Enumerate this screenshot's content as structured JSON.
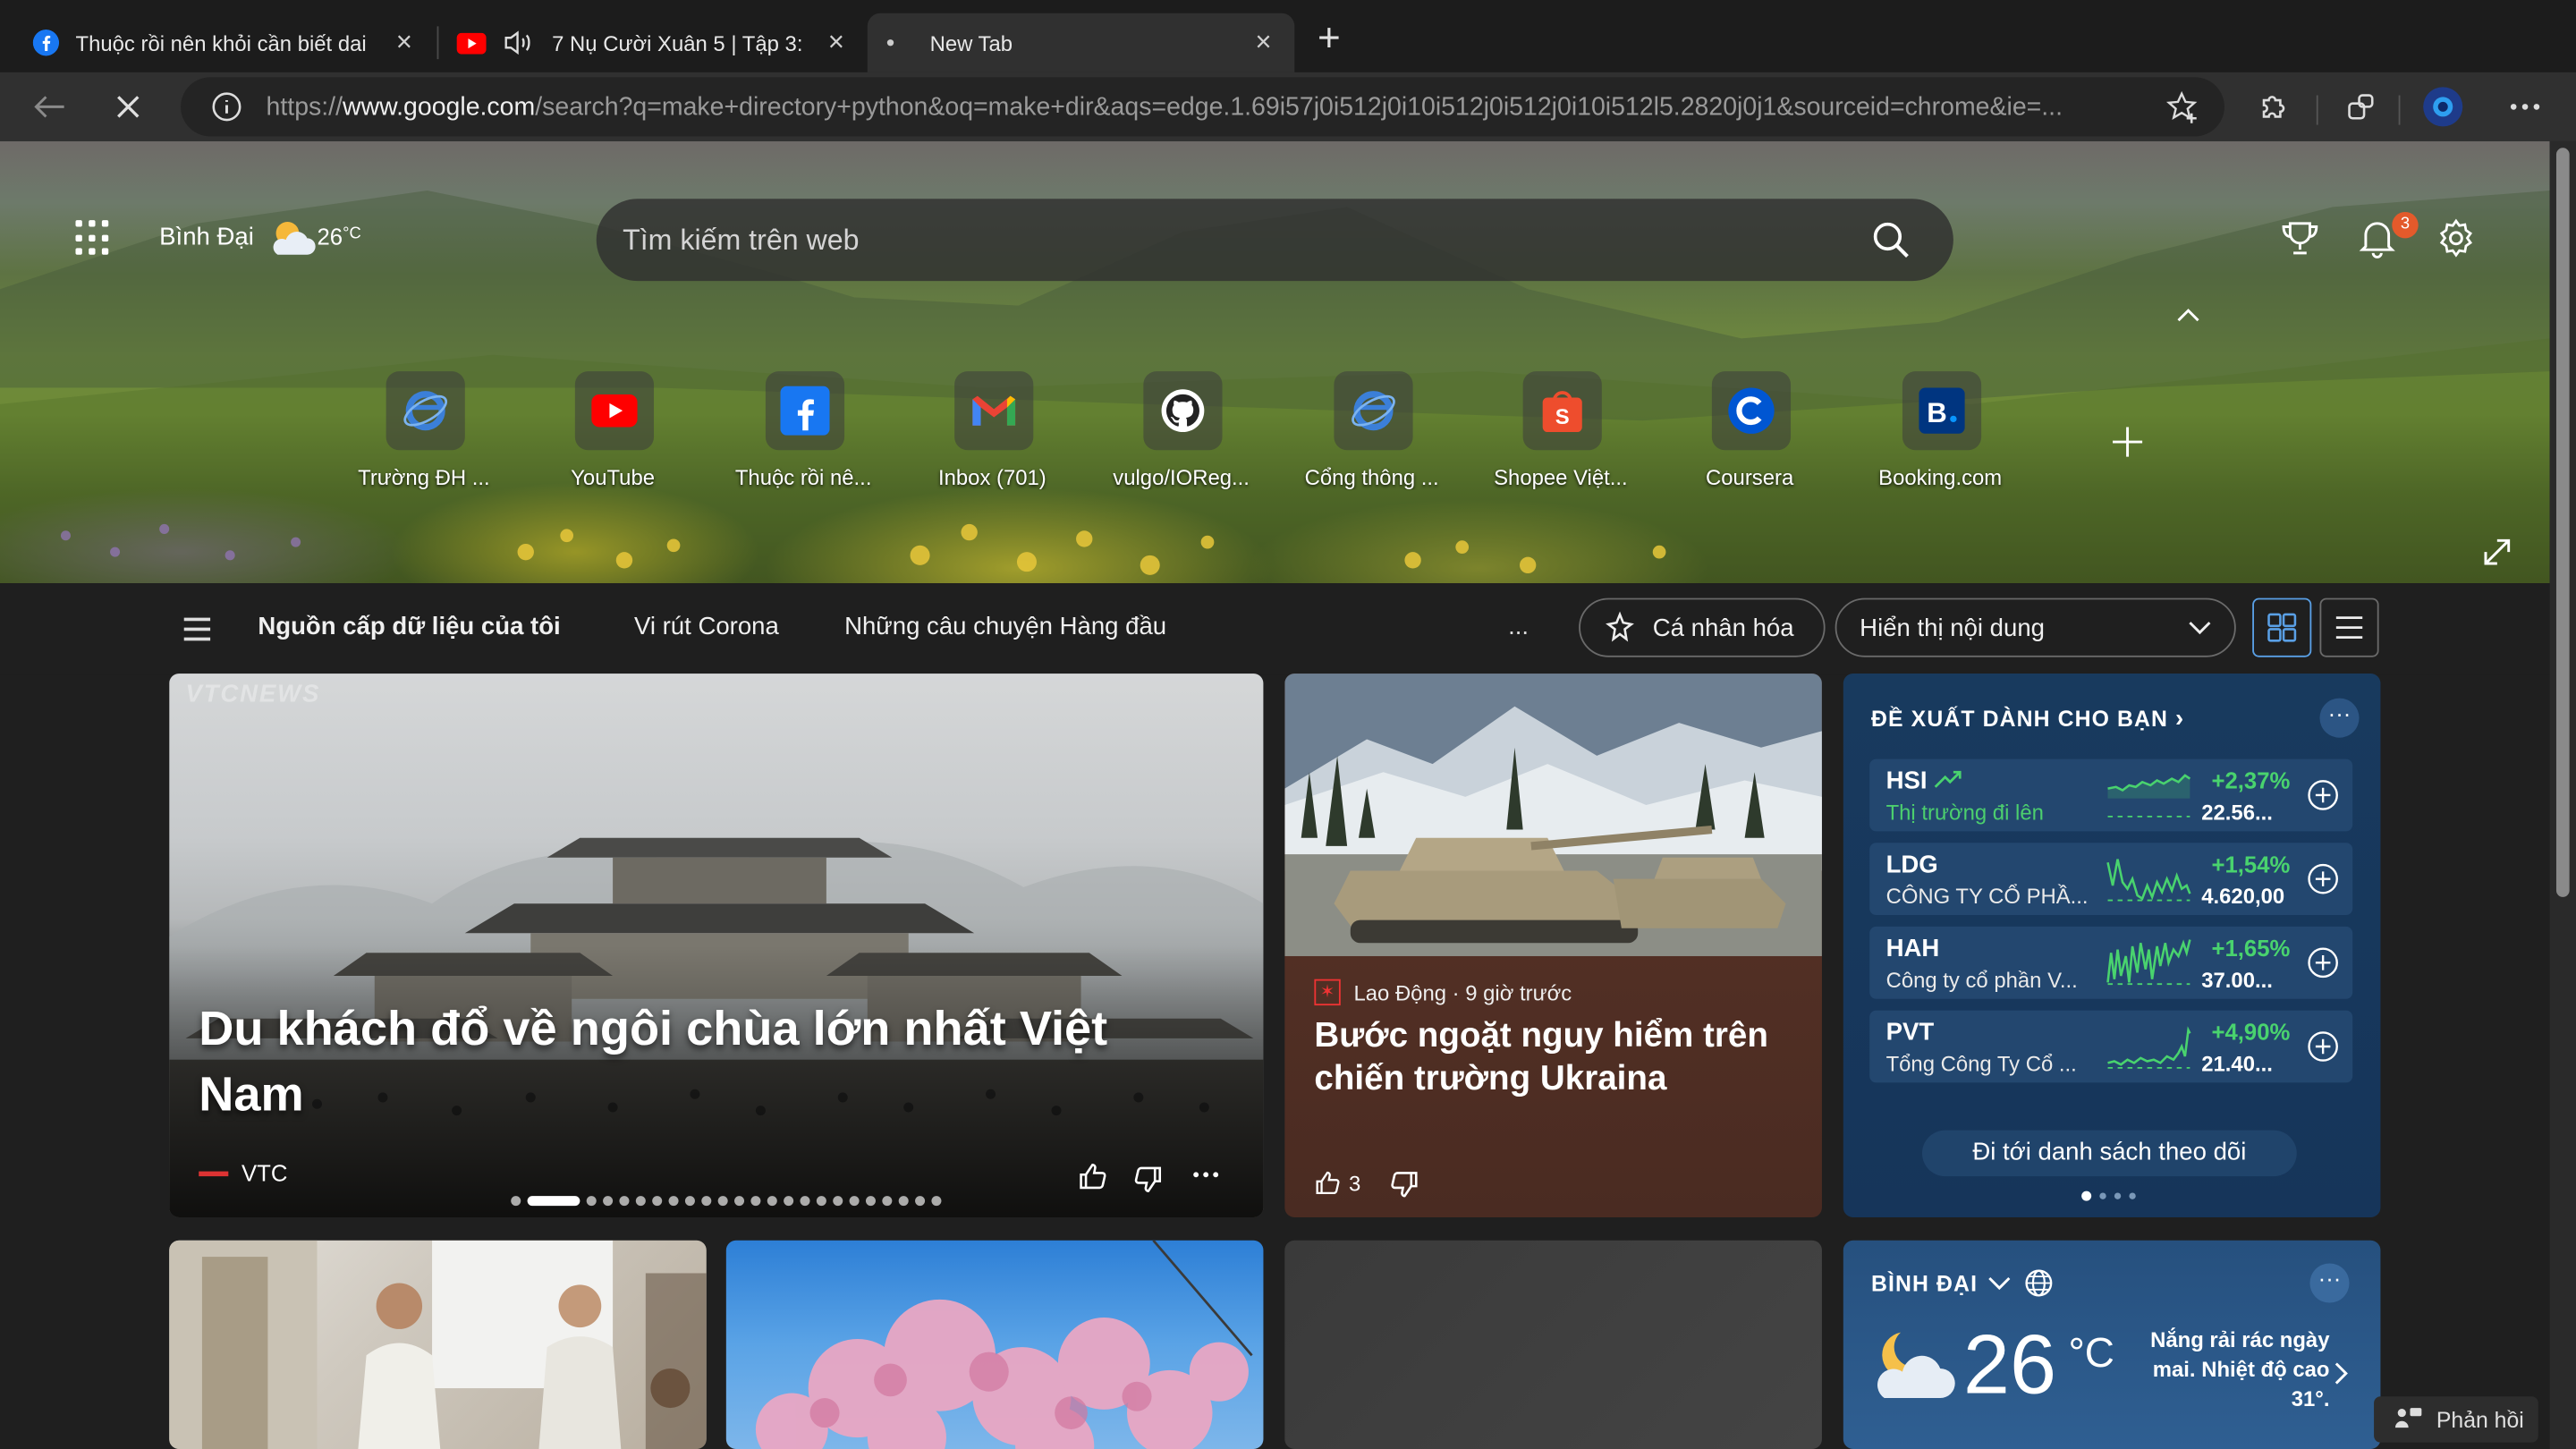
{
  "tabs": [
    {
      "title": "Thuộc rồi nên khỏi cần biết dai",
      "favicon": "facebook-icon",
      "active": false
    },
    {
      "title": "7 Nụ Cười Xuân 5 | Tập 3:",
      "favicon": "youtube-icon",
      "active": false,
      "audio": true
    },
    {
      "title": "New Tab",
      "favicon": "loading-dot",
      "active": true
    }
  ],
  "address_bar": {
    "scheme": "https://",
    "host": "www.google.com",
    "path": "/search?q=make+directory+python&oq=make+dir&aqs=edge.1.69i57j0i512j0i10i512j0i512j0i10i512l5.2820j0j1&sourceid=chrome&ie=..."
  },
  "header": {
    "location": "Bình Đại",
    "temperature": "26",
    "temp_unit": "°C",
    "search_placeholder": "Tìm kiếm trên web",
    "notification_count": "3"
  },
  "quick_links": [
    {
      "label": "Trường ĐH ...",
      "icon": "ie-globe-icon"
    },
    {
      "label": "YouTube",
      "icon": "youtube-icon"
    },
    {
      "label": "Thuộc rồi nê...",
      "icon": "facebook-icon"
    },
    {
      "label": "Inbox (701)",
      "icon": "gmail-icon"
    },
    {
      "label": "vulgo/IOReg...",
      "icon": "github-icon"
    },
    {
      "label": "Cổng thông ...",
      "icon": "ie-globe-icon"
    },
    {
      "label": "Shopee Việt...",
      "icon": "shopee-icon"
    },
    {
      "label": "Coursera",
      "icon": "coursera-icon"
    },
    {
      "label": "Booking.com",
      "icon": "booking-icon"
    }
  ],
  "feed_nav": {
    "items": [
      "Nguồn cấp dữ liệu của tôi",
      "Vi rút Corona",
      "Những câu chuyện Hàng đầu"
    ],
    "more": "...",
    "personalize": "Cá nhân hóa",
    "content_select": "Hiển thị nội dung"
  },
  "hero_story": {
    "watermark": "VTCNEWS",
    "title": "Du khách đổ về ngôi chùa lớn nhất Việt Nam",
    "source": "VTC",
    "slide_count": 24,
    "active_slide": 1
  },
  "news_story": {
    "source": "Lao Động · 9 giờ trước",
    "title": "Bước ngoặt nguy hiểm trên chiến trường Ukraina",
    "likes": "3"
  },
  "stocks": {
    "heading": "ĐỀ XUẤT DÀNH CHO BẠN",
    "more": "···",
    "items": [
      {
        "symbol": "HSI",
        "name": "Thị trường đi lên",
        "change": "+2,37%",
        "price": "22.56...",
        "trend": "up"
      },
      {
        "symbol": "LDG",
        "name": "CÔNG TY CỔ PHẦ...",
        "change": "+1,54%",
        "price": "4.620,00"
      },
      {
        "symbol": "HAH",
        "name": "Công ty cổ phần V...",
        "change": "+1,65%",
        "price": "37.00..."
      },
      {
        "symbol": "PVT",
        "name": "Tổng Công Ty Cổ ...",
        "change": "+4,90%",
        "price": "21.40..."
      }
    ],
    "watchlist_button": "Đi tới danh sách theo dõi"
  },
  "weather": {
    "location": "BÌNH ĐẠI",
    "temperature": "26",
    "unit": "°C",
    "description": "Nắng rải rác ngày mai. Nhiệt độ cao 31°.",
    "more": "···"
  },
  "feedback_label": "Phản hồi",
  "colors": {
    "accent": "#5aa0e6",
    "stock_up": "#49d36e",
    "badge": "#e35a2b",
    "stock_card": "#183a5e"
  }
}
